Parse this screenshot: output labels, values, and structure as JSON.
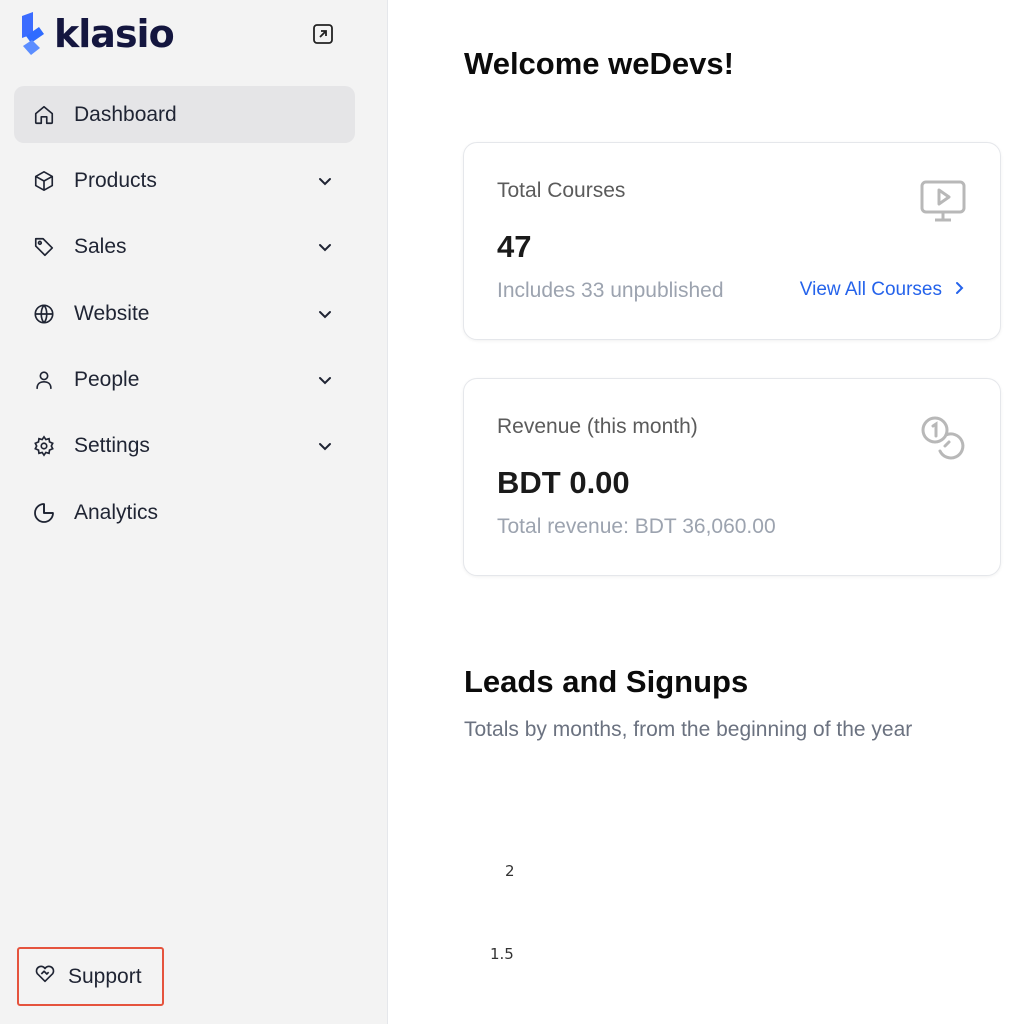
{
  "brand": {
    "name": "klasio",
    "accent": "#2f6bff"
  },
  "sidebar": {
    "items": [
      {
        "label": "Dashboard",
        "icon": "home-icon",
        "active": true,
        "expandable": false
      },
      {
        "label": "Products",
        "icon": "box-icon",
        "active": false,
        "expandable": true
      },
      {
        "label": "Sales",
        "icon": "tag-icon",
        "active": false,
        "expandable": true
      },
      {
        "label": "Website",
        "icon": "globe-icon",
        "active": false,
        "expandable": true
      },
      {
        "label": "People",
        "icon": "user-icon",
        "active": false,
        "expandable": true
      },
      {
        "label": "Settings",
        "icon": "gear-icon",
        "active": false,
        "expandable": true
      },
      {
        "label": "Analytics",
        "icon": "pie-chart-icon",
        "active": false,
        "expandable": false
      }
    ],
    "support_label": "Support"
  },
  "main": {
    "welcome": "Welcome weDevs!",
    "cards": {
      "courses": {
        "title": "Total Courses",
        "value": "47",
        "sub": "Includes 33 unpublished",
        "link": "View All Courses"
      },
      "revenue": {
        "title": "Revenue (this month)",
        "value": "BDT 0.00",
        "sub": "Total revenue: BDT 36,060.00"
      }
    },
    "leads": {
      "title": "Leads and Signups",
      "subtitle": "Totals by months, from the beginning of the year"
    }
  },
  "chart_data": {
    "type": "line",
    "y_ticks_visible": [
      "2",
      "1.5"
    ]
  }
}
